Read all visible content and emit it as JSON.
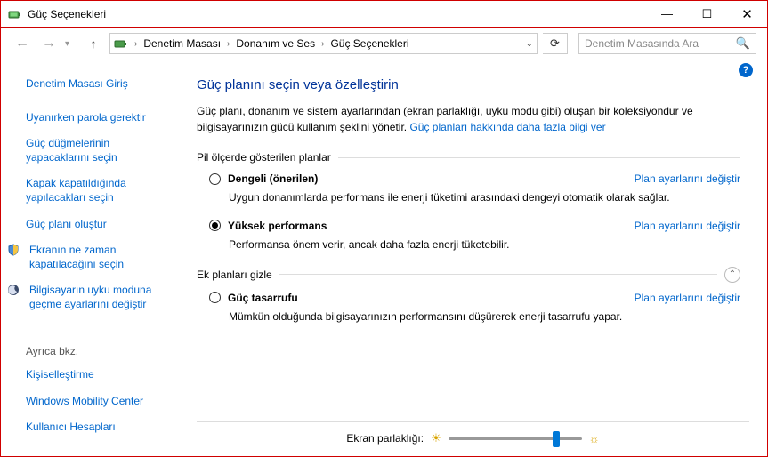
{
  "window": {
    "title": "Güç Seçenekleri",
    "minimize": "—",
    "maximize": "☐",
    "close": "✕"
  },
  "nav": {
    "back": "←",
    "forward": "→",
    "dropdown": "▾",
    "up": "↑",
    "refresh": "⟳",
    "addr_dd": "⌄"
  },
  "breadcrumb": {
    "sep": "›",
    "items": [
      "Denetim Masası",
      "Donanım ve Ses",
      "Güç Seçenekleri"
    ]
  },
  "search": {
    "placeholder": "Denetim Masasında Ara",
    "icon": "🔍"
  },
  "help": "?",
  "sidebar": {
    "home": "Denetim Masası Giriş",
    "links": [
      "Uyanırken parola gerektir",
      "Güç düğmelerinin yapacaklarını seçin",
      "Kapak kapatıldığında yapılacakları seçin",
      "Güç planı oluştur"
    ],
    "icon_links": [
      {
        "icon": "shield",
        "label": "Ekranın ne zaman kapatılacağını seçin"
      },
      {
        "icon": "moon",
        "label": "Bilgisayarın uyku moduna geçme ayarlarını değiştir"
      }
    ],
    "seealso_title": "Ayrıca bkz.",
    "seealso": [
      "Kişiselleştirme",
      "Windows Mobility Center",
      "Kullanıcı Hesapları"
    ]
  },
  "main": {
    "heading": "Güç planını seçin veya özelleştirin",
    "intro_text": "Güç planı, donanım ve sistem ayarlarından (ekran parlaklığı, uyku modu gibi) oluşan bir koleksiyondur ve bilgisayarınızın gücü kullanım şeklini yönetir. ",
    "intro_link": "Güç planları hakkında daha fazla bilgi ver",
    "section1": "Pil ölçerde gösterilen planlar",
    "section2": "Ek planları gizle",
    "change_link": "Plan ayarlarını değiştir",
    "plans_primary": [
      {
        "name": "Dengeli (önerilen)",
        "desc": "Uygun donanımlarda performans ile enerji tüketimi arasındaki dengeyi otomatik olarak sağlar.",
        "checked": false
      },
      {
        "name": "Yüksek performans",
        "desc": "Performansa önem verir, ancak daha fazla enerji tüketebilir.",
        "checked": true
      }
    ],
    "plans_extra": [
      {
        "name": "Güç tasarrufu",
        "desc": "Mümkün olduğunda bilgisayarınızın performansını düşürerek enerji tasarrufu yapar.",
        "checked": false
      }
    ]
  },
  "footer": {
    "label": "Ekran parlaklığı:",
    "sun_low": "☀",
    "sun_high": "☼"
  }
}
